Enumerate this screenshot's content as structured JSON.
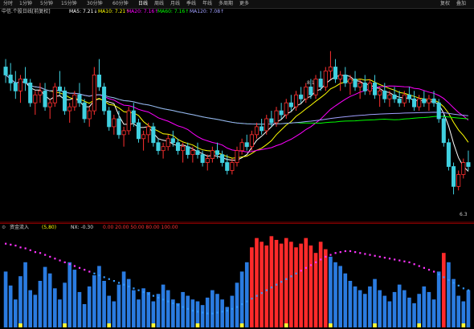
{
  "periods": [
    "分时",
    "1分钟",
    "5分钟",
    "15分钟",
    "30分钟",
    "60分钟",
    "日线",
    "周线",
    "月线",
    "季线",
    "年线",
    "多周期",
    "更多"
  ],
  "active_period": "日线",
  "right_buttons": [
    "复权",
    "叠加"
  ],
  "stock_title": "中信.个股日线[前复权]",
  "ma_labels": [
    {
      "text": "MA5: 7.21↓",
      "color": "#ffffff"
    },
    {
      "text": "MA10: 7.21↑",
      "color": "#ffff00"
    },
    {
      "text": "MA20: 7.16↑",
      "color": "#ff00ff"
    },
    {
      "text": "MA60: 7.16↑",
      "color": "#00ff00"
    },
    {
      "text": "MA120: 7.08↑",
      "color": "#a0a0ff"
    }
  ],
  "price_marks": {
    "high": "8.1",
    "low": "6.3"
  },
  "sub_indicator": {
    "title": "资金流入",
    "params": "(5,80)",
    "nx_label": "NX: -0.30",
    "levels": "0.00  20.00  50.00  80.00  100.00",
    "level_color": "#ff3333"
  },
  "chart_data": {
    "type": "candlestick+bar",
    "price_ylim": [
      6.0,
      8.5
    ],
    "candles": [
      [
        7.9,
        8.0,
        7.7,
        7.8
      ],
      [
        7.8,
        7.95,
        7.6,
        7.7
      ],
      [
        7.7,
        7.85,
        7.5,
        7.6
      ],
      [
        7.6,
        7.8,
        7.45,
        7.75
      ],
      [
        7.75,
        7.9,
        7.6,
        7.7
      ],
      [
        7.7,
        7.75,
        7.4,
        7.45
      ],
      [
        7.45,
        7.6,
        7.3,
        7.55
      ],
      [
        7.55,
        7.7,
        7.45,
        7.6
      ],
      [
        7.6,
        7.7,
        7.35,
        7.4
      ],
      [
        7.4,
        7.5,
        7.25,
        7.45
      ],
      [
        7.45,
        7.7,
        7.4,
        7.65
      ],
      [
        7.65,
        7.85,
        7.55,
        7.6
      ],
      [
        7.6,
        7.65,
        7.3,
        7.35
      ],
      [
        7.35,
        7.45,
        7.2,
        7.4
      ],
      [
        7.4,
        7.6,
        7.35,
        7.55
      ],
      [
        7.55,
        7.7,
        7.4,
        7.45
      ],
      [
        7.45,
        7.5,
        7.2,
        7.25
      ],
      [
        7.25,
        7.4,
        7.15,
        7.35
      ],
      [
        7.35,
        7.9,
        7.3,
        7.8
      ],
      [
        7.8,
        8.0,
        7.6,
        7.65
      ],
      [
        7.65,
        7.7,
        7.3,
        7.35
      ],
      [
        7.35,
        7.4,
        7.1,
        7.15
      ],
      [
        7.15,
        7.3,
        7.05,
        7.25
      ],
      [
        7.25,
        7.35,
        7.0,
        7.05
      ],
      [
        7.05,
        7.15,
        6.9,
        7.1
      ],
      [
        7.1,
        7.4,
        7.05,
        7.35
      ],
      [
        7.35,
        7.45,
        7.15,
        7.2
      ],
      [
        7.2,
        7.25,
        6.95,
        7.0
      ],
      [
        7.0,
        7.1,
        6.85,
        7.05
      ],
      [
        7.05,
        7.2,
        6.95,
        7.15
      ],
      [
        7.15,
        7.2,
        6.9,
        6.95
      ],
      [
        6.95,
        7.0,
        6.8,
        6.85
      ],
      [
        6.85,
        6.95,
        6.75,
        6.9
      ],
      [
        6.9,
        7.05,
        6.85,
        7.0
      ],
      [
        7.0,
        7.1,
        6.9,
        6.95
      ],
      [
        6.95,
        7.0,
        6.8,
        6.85
      ],
      [
        6.85,
        6.95,
        6.7,
        6.9
      ],
      [
        6.9,
        6.95,
        6.75,
        6.8
      ],
      [
        6.8,
        6.9,
        6.7,
        6.85
      ],
      [
        6.85,
        6.95,
        6.75,
        6.8
      ],
      [
        6.8,
        6.85,
        6.65,
        6.7
      ],
      [
        6.7,
        6.8,
        6.6,
        6.75
      ],
      [
        6.75,
        6.9,
        6.7,
        6.85
      ],
      [
        6.85,
        6.95,
        6.75,
        6.8
      ],
      [
        6.8,
        6.85,
        6.65,
        6.7
      ],
      [
        6.7,
        6.8,
        6.55,
        6.6
      ],
      [
        6.6,
        6.75,
        6.55,
        6.7
      ],
      [
        6.7,
        6.9,
        6.65,
        6.85
      ],
      [
        6.85,
        7.0,
        6.8,
        6.95
      ],
      [
        6.95,
        7.05,
        6.85,
        6.9
      ],
      [
        6.9,
        7.1,
        6.85,
        7.05
      ],
      [
        7.05,
        7.2,
        7.0,
        7.15
      ],
      [
        7.15,
        7.25,
        7.05,
        7.1
      ],
      [
        7.1,
        7.3,
        7.05,
        7.25
      ],
      [
        7.25,
        7.35,
        7.15,
        7.2
      ],
      [
        7.2,
        7.4,
        7.15,
        7.35
      ],
      [
        7.35,
        7.45,
        7.25,
        7.3
      ],
      [
        7.3,
        7.5,
        7.25,
        7.45
      ],
      [
        7.45,
        7.55,
        7.35,
        7.4
      ],
      [
        7.4,
        7.6,
        7.35,
        7.55
      ],
      [
        7.55,
        7.65,
        7.45,
        7.5
      ],
      [
        7.5,
        7.7,
        7.45,
        7.65
      ],
      [
        7.65,
        7.75,
        7.5,
        7.55
      ],
      [
        7.55,
        7.8,
        7.5,
        7.75
      ],
      [
        7.75,
        7.85,
        7.6,
        7.65
      ],
      [
        7.65,
        7.9,
        7.6,
        7.85
      ],
      [
        7.85,
        8.1,
        7.75,
        7.9
      ],
      [
        7.9,
        8.0,
        7.7,
        7.75
      ],
      [
        7.75,
        7.85,
        7.6,
        7.8
      ],
      [
        7.8,
        7.9,
        7.65,
        7.7
      ],
      [
        7.7,
        7.8,
        7.55,
        7.75
      ],
      [
        7.75,
        7.85,
        7.6,
        7.65
      ],
      [
        7.65,
        7.75,
        7.5,
        7.7
      ],
      [
        7.7,
        7.8,
        7.55,
        7.6
      ],
      [
        7.6,
        7.75,
        7.55,
        7.7
      ],
      [
        7.7,
        7.8,
        7.5,
        7.55
      ],
      [
        7.55,
        7.65,
        7.4,
        7.6
      ],
      [
        7.6,
        7.7,
        7.45,
        7.5
      ],
      [
        7.5,
        7.6,
        7.4,
        7.55
      ],
      [
        7.55,
        7.65,
        7.45,
        7.5
      ],
      [
        7.5,
        7.6,
        7.4,
        7.45
      ],
      [
        7.45,
        7.6,
        7.4,
        7.55
      ],
      [
        7.55,
        7.65,
        7.45,
        7.5
      ],
      [
        7.5,
        7.6,
        7.35,
        7.4
      ],
      [
        7.4,
        7.55,
        7.35,
        7.5
      ],
      [
        7.5,
        7.6,
        7.4,
        7.45
      ],
      [
        7.45,
        7.55,
        7.35,
        7.5
      ],
      [
        7.5,
        7.6,
        7.4,
        7.45
      ],
      [
        7.45,
        7.5,
        7.2,
        7.25
      ],
      [
        7.25,
        7.3,
        6.9,
        6.95
      ],
      [
        6.95,
        7.0,
        6.6,
        6.65
      ],
      [
        6.65,
        6.7,
        6.3,
        6.4
      ],
      [
        6.4,
        6.6,
        6.35,
        6.55
      ],
      [
        6.55,
        6.75,
        6.5,
        6.7
      ],
      [
        6.7,
        6.85,
        6.6,
        6.65
      ]
    ],
    "ma_series": [
      {
        "name": "MA5",
        "color": "#ffffff"
      },
      {
        "name": "MA10",
        "color": "#ffff00"
      },
      {
        "name": "MA20",
        "color": "#ff00ff"
      },
      {
        "name": "MA60",
        "color": "#00ff00"
      },
      {
        "name": "MA120",
        "color": "#a0a0ff"
      }
    ],
    "flow_ylim": [
      0,
      100
    ],
    "flow_values": [
      60,
      45,
      30,
      55,
      70,
      40,
      35,
      50,
      65,
      58,
      42,
      30,
      48,
      70,
      62,
      38,
      25,
      44,
      56,
      66,
      50,
      34,
      28,
      46,
      60,
      52,
      40,
      30,
      42,
      38,
      28,
      36,
      46,
      40,
      30,
      26,
      38,
      34,
      30,
      28,
      24,
      32,
      40,
      36,
      30,
      22,
      34,
      48,
      60,
      70,
      86,
      96,
      92,
      88,
      98,
      94,
      90,
      96,
      92,
      86,
      90,
      96,
      88,
      80,
      92,
      84,
      76,
      70,
      66,
      58,
      50,
      44,
      40,
      36,
      44,
      52,
      40,
      34,
      28,
      38,
      46,
      40,
      32,
      26,
      36,
      44,
      38,
      30,
      60,
      80,
      70,
      52,
      34,
      28,
      40
    ],
    "flow_colors": "red when >= 80 region (main inflow), blue otherwise",
    "line_values": [
      90,
      89,
      88,
      86,
      85,
      83,
      81,
      80,
      78,
      76,
      74,
      72,
      70,
      68,
      66,
      64,
      62,
      60,
      58,
      56,
      54,
      52,
      50,
      48,
      46,
      44,
      42,
      40,
      38,
      36,
      34,
      32,
      30,
      28,
      26,
      24,
      22,
      20,
      18,
      17,
      16,
      15,
      15,
      16,
      17,
      18,
      20,
      22,
      25,
      28,
      31,
      34,
      37,
      40,
      43,
      46,
      49,
      52,
      55,
      58,
      61,
      64,
      67,
      70,
      73,
      76,
      78,
      80,
      81,
      82,
      82,
      81,
      80,
      79,
      78,
      77,
      76,
      75,
      74,
      73,
      72,
      71,
      70,
      68,
      66,
      64,
      62,
      60,
      57,
      54,
      51,
      48,
      45,
      42,
      40
    ]
  }
}
